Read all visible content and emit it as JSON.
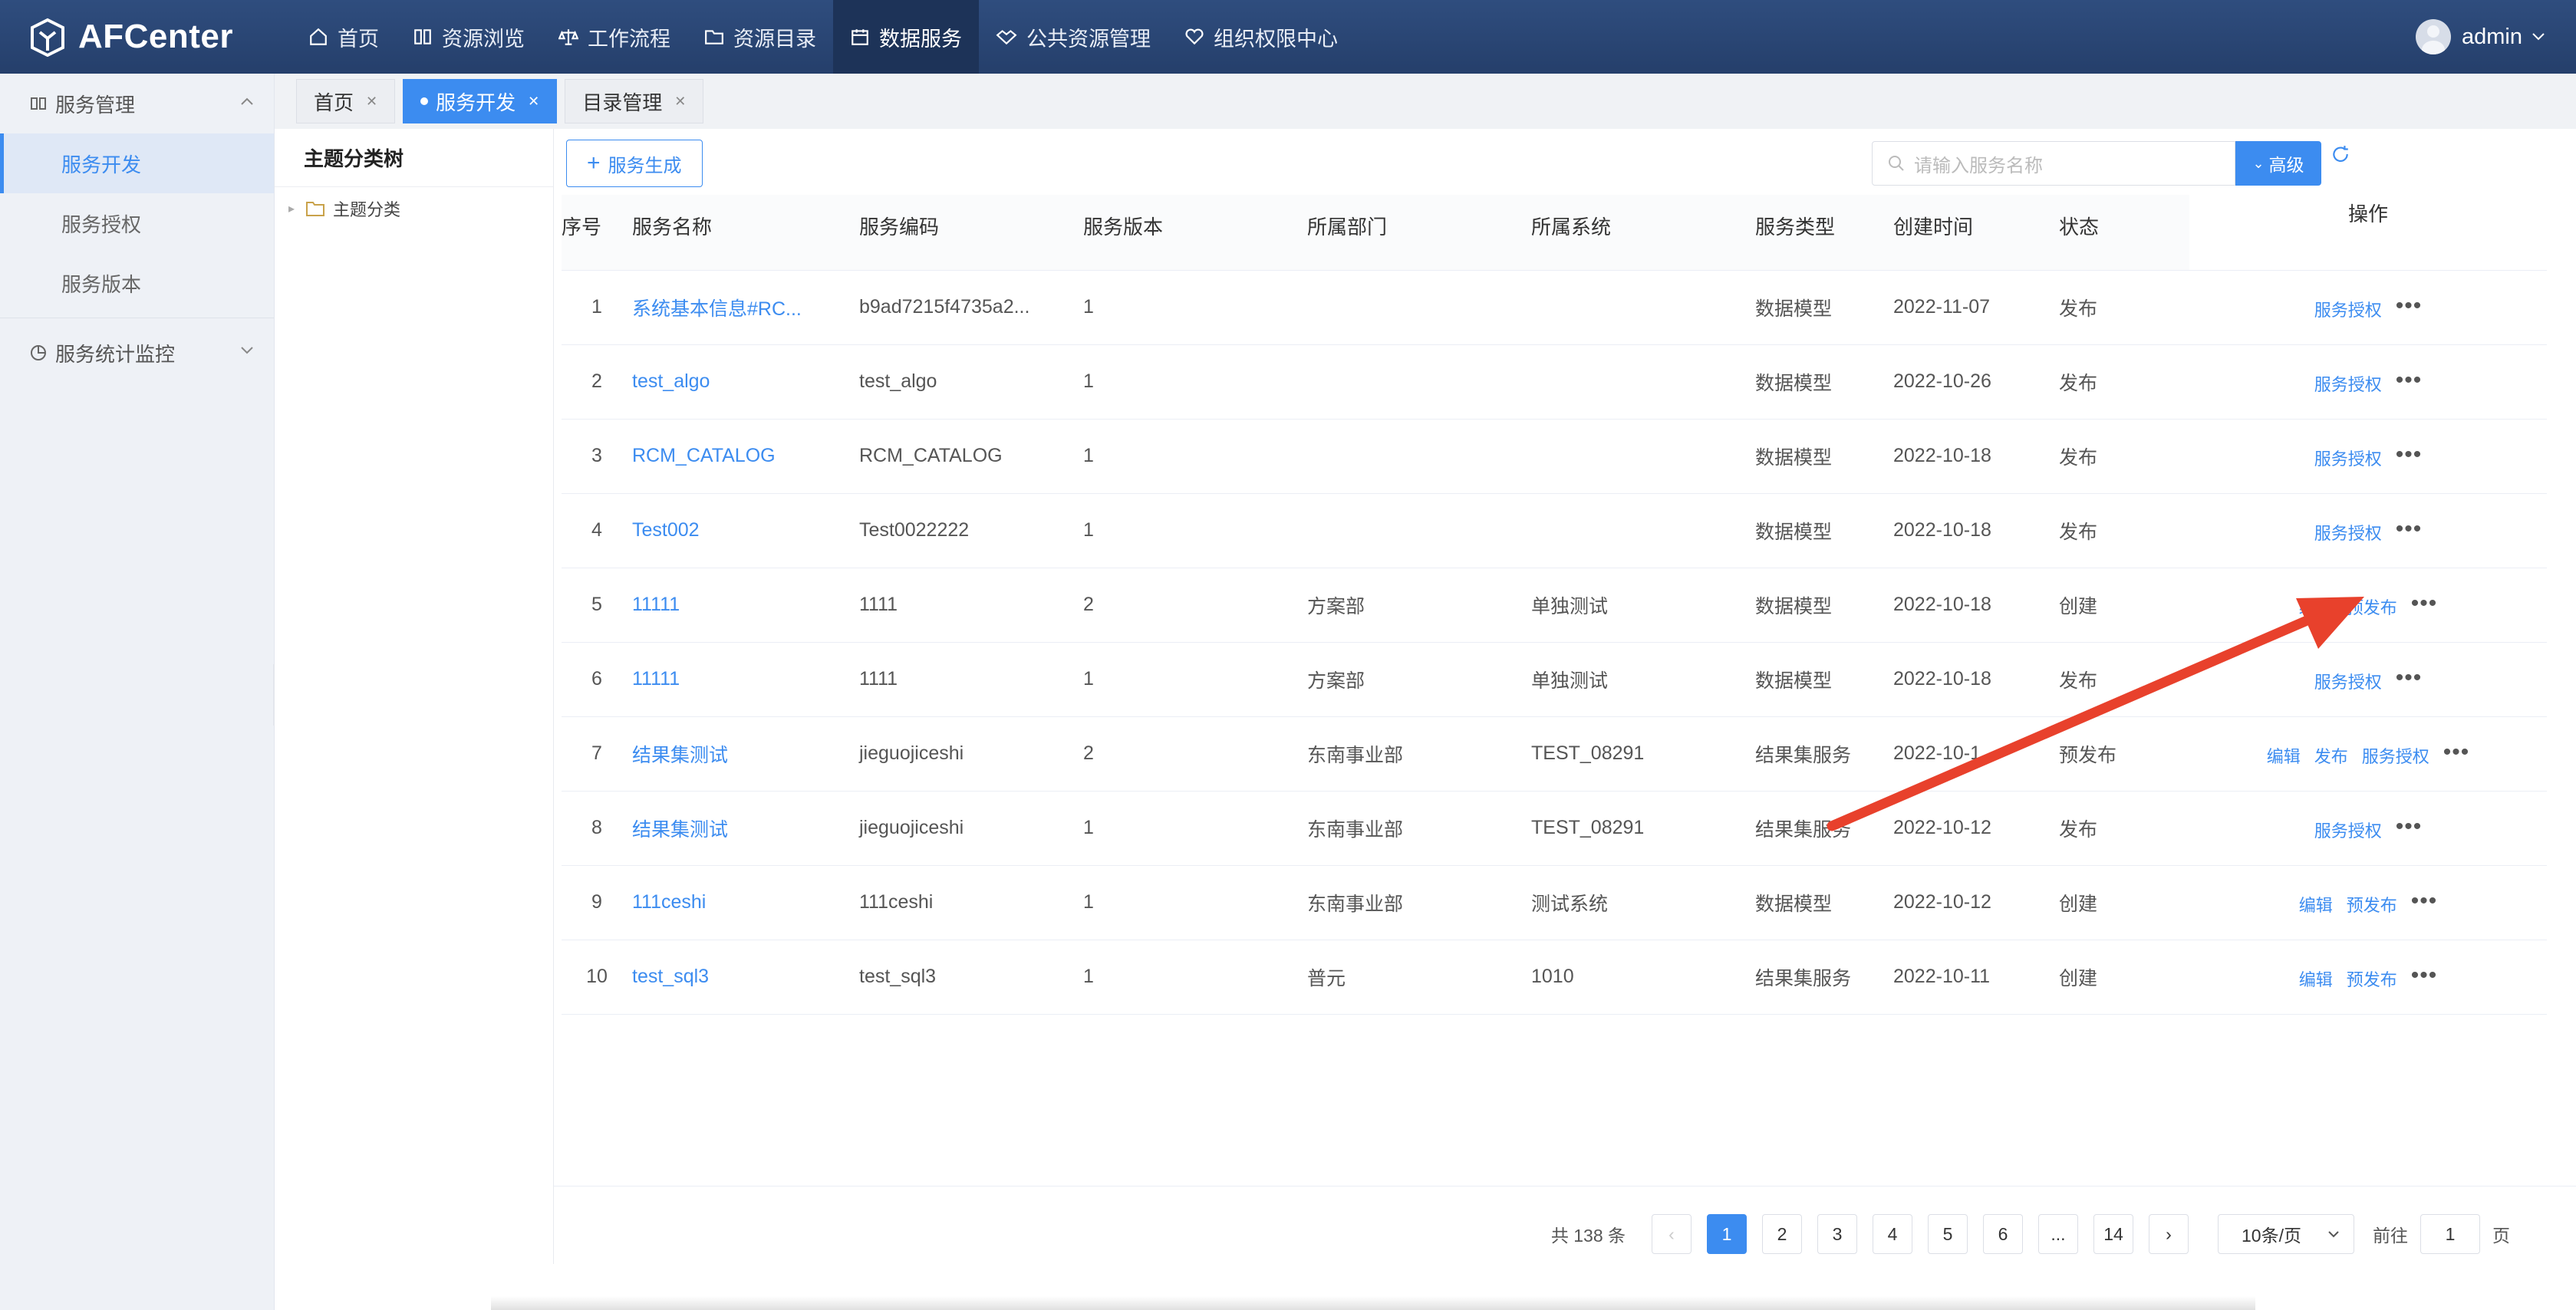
{
  "app": {
    "logo_text": "AFCenter"
  },
  "topnav": [
    {
      "label": "首页",
      "icon": "home-icon"
    },
    {
      "label": "资源浏览",
      "icon": "book-icon"
    },
    {
      "label": "工作流程",
      "icon": "scale-icon"
    },
    {
      "label": "资源目录",
      "icon": "folder-icon"
    },
    {
      "label": "数据服务",
      "icon": "calendar-icon",
      "active": true
    },
    {
      "label": "公共资源管理",
      "icon": "handshake-icon"
    },
    {
      "label": "组织权限中心",
      "icon": "heart-icon"
    }
  ],
  "user": {
    "name": "admin"
  },
  "sidebar": {
    "group1": "服务管理",
    "items": [
      "服务开发",
      "服务授权",
      "服务版本"
    ],
    "group2": "服务统计监控"
  },
  "tabs": [
    {
      "label": "首页"
    },
    {
      "label": "服务开发",
      "active": true
    },
    {
      "label": "目录管理"
    }
  ],
  "tree": {
    "title": "主题分类树",
    "root": "主题分类"
  },
  "toolbar": {
    "generate_label": "服务生成",
    "search_placeholder": "请输入服务名称",
    "advanced_label": "高级"
  },
  "table": {
    "headers": [
      "序号",
      "服务名称",
      "服务编码",
      "服务版本",
      "所属部门",
      "所属系统",
      "服务类型",
      "创建时间",
      "状态",
      "操作"
    ],
    "rows": [
      {
        "idx": "1",
        "name": "系统基本信息#RC...",
        "code": "b9ad7215f4735a2...",
        "ver": "1",
        "dept": "",
        "sys": "",
        "type": "数据模型",
        "time": "2022-11-07",
        "status": "发布",
        "ops": [
          "服务授权"
        ]
      },
      {
        "idx": "2",
        "name": "test_algo",
        "code": "test_algo",
        "ver": "1",
        "dept": "",
        "sys": "",
        "type": "数据模型",
        "time": "2022-10-26",
        "status": "发布",
        "ops": [
          "服务授权"
        ]
      },
      {
        "idx": "3",
        "name": "RCM_CATALOG",
        "code": "RCM_CATALOG",
        "ver": "1",
        "dept": "",
        "sys": "",
        "type": "数据模型",
        "time": "2022-10-18",
        "status": "发布",
        "ops": [
          "服务授权"
        ]
      },
      {
        "idx": "4",
        "name": "Test002",
        "code": "Test0022222",
        "ver": "1",
        "dept": "",
        "sys": "",
        "type": "数据模型",
        "time": "2022-10-18",
        "status": "发布",
        "ops": [
          "服务授权"
        ]
      },
      {
        "idx": "5",
        "name": "11111",
        "code": "1111",
        "ver": "2",
        "dept": "方案部",
        "sys": "单独测试",
        "type": "数据模型",
        "time": "2022-10-18",
        "status": "创建",
        "ops": [
          "编辑",
          "预发布"
        ]
      },
      {
        "idx": "6",
        "name": "11111",
        "code": "1111",
        "ver": "1",
        "dept": "方案部",
        "sys": "单独测试",
        "type": "数据模型",
        "time": "2022-10-18",
        "status": "发布",
        "ops": [
          "服务授权"
        ]
      },
      {
        "idx": "7",
        "name": "结果集测试",
        "code": "jieguojiceshi",
        "ver": "2",
        "dept": "东南事业部",
        "sys": "TEST_08291",
        "type": "结果集服务",
        "time": "2022-10-1",
        "status": "预发布",
        "ops": [
          "编辑",
          "发布",
          "服务授权"
        ]
      },
      {
        "idx": "8",
        "name": "结果集测试",
        "code": "jieguojiceshi",
        "ver": "1",
        "dept": "东南事业部",
        "sys": "TEST_08291",
        "type": "结果集服务",
        "time": "2022-10-12",
        "status": "发布",
        "ops": [
          "服务授权"
        ]
      },
      {
        "idx": "9",
        "name": "111ceshi",
        "code": "111ceshi",
        "ver": "1",
        "dept": "东南事业部",
        "sys": "测试系统",
        "type": "数据模型",
        "time": "2022-10-12",
        "status": "创建",
        "ops": [
          "编辑",
          "预发布"
        ]
      },
      {
        "idx": "10",
        "name": "test_sql3",
        "code": "test_sql3",
        "ver": "1",
        "dept": "普元",
        "sys": "1010",
        "type": "结果集服务",
        "time": "2022-10-11",
        "status": "创建",
        "ops": [
          "编辑",
          "预发布"
        ]
      }
    ]
  },
  "pagination": {
    "total": "共 138 条",
    "pages": [
      "1",
      "2",
      "3",
      "4",
      "5",
      "6",
      "...",
      "14"
    ],
    "current": "1",
    "page_size": "10条/页",
    "goto_prefix": "前往",
    "goto_value": "1",
    "goto_suffix": "页"
  },
  "colors": {
    "accent": "#3c8cf0",
    "header": "#2f4d7e",
    "annotation": "#e8412c"
  }
}
